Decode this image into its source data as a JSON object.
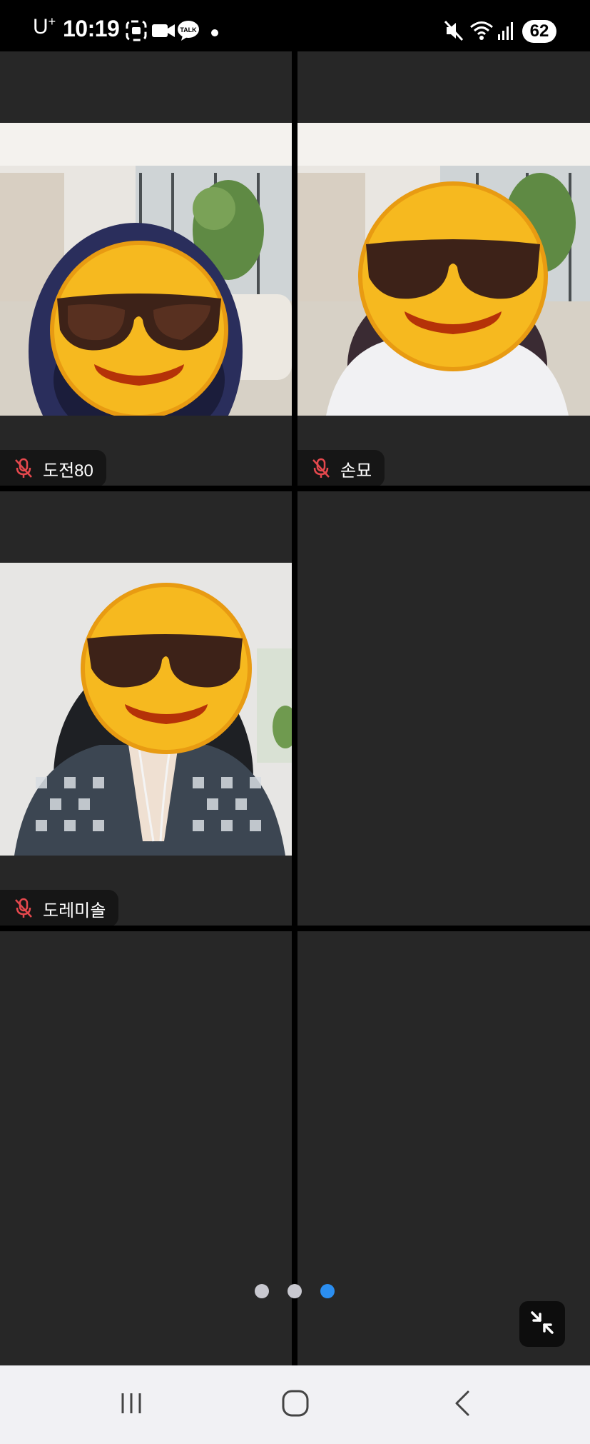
{
  "status_bar": {
    "carrier": "U",
    "carrier_sup": "+",
    "time": "10:19",
    "battery": "62",
    "left_icons": [
      "screenshot-icon",
      "video-camera-icon",
      "kakaotalk-icon",
      "notification-dot-icon"
    ],
    "right_icons": [
      "mute-icon",
      "wifi-icon",
      "signal-icon",
      "battery-icon"
    ]
  },
  "participants": [
    {
      "name": "도전80",
      "muted": true
    },
    {
      "name": "손묘",
      "muted": true
    },
    {
      "name": "도레미솔",
      "muted": true
    }
  ],
  "pagination": {
    "pages": 3,
    "active": 3
  },
  "colors": {
    "tile": "#272727",
    "mic_muted": "#e5484d",
    "active_dot": "#2b8ef0",
    "inactive_dot": "#c8c8cf"
  },
  "nav_bar": {
    "buttons": [
      "recent-apps",
      "home",
      "back"
    ]
  }
}
